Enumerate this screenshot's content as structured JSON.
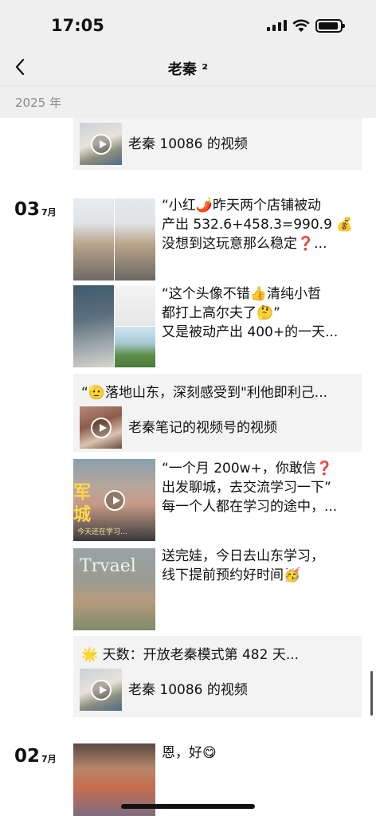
{
  "status_bar": {
    "time": "17:05"
  },
  "nav": {
    "title": "老秦 ²"
  },
  "year": "2025 年",
  "groups": [
    {
      "items": [
        {
          "type": "video-card",
          "title": "老秦 10086 的视频"
        }
      ]
    },
    {
      "day": "03",
      "month": "7月",
      "items": [
        {
          "type": "post",
          "lines": [
            "“小红🌶️昨天两个店铺被动",
            "产出 532.6+458.3=990.9 💰",
            "没想到这玩意那么稳定❓..."
          ]
        },
        {
          "type": "post",
          "lines": [
            "“这个头像不错👍清纯小哲",
            "都打上高尔夫了🤔”",
            "又是被动产出 400+的一天..."
          ]
        },
        {
          "type": "quote-video-card",
          "quote": "“🫡落地山东，深刻感受到\"利他即利己...",
          "title": "老秦笔记的视频号的视频"
        },
        {
          "type": "post",
          "thumb_overlay_lines": [
            "军",
            "城"
          ],
          "thumb_caption": "今天还在学习...",
          "lines": [
            "“一个月 200w+，你敢信❓",
            "出发聊城，去交流学习一下”",
            "每一个人都在学习的途中，..."
          ]
        },
        {
          "type": "post",
          "thumb_overlay_lines": [
            "Trvael"
          ],
          "lines": [
            "送完娃，今日去山东学习，",
            "线下提前预约好时间🥳"
          ]
        },
        {
          "type": "quote-video-card",
          "quote": "🌟 天数：开放老秦模式第 482 天...",
          "title": "老秦 10086 的视频"
        }
      ]
    },
    {
      "day": "02",
      "month": "7月",
      "items": [
        {
          "type": "post",
          "lines": [
            "恩，好😋"
          ]
        }
      ]
    }
  ],
  "icons": {
    "back": "chevron-left-icon",
    "signal": "cellular-signal-icon",
    "wifi": "wifi-icon",
    "battery": "battery-icon",
    "play": "play-icon"
  },
  "colors": {
    "header_bg": "#efefef",
    "card_bg": "#f3f3f3",
    "muted_text": "#8a8a8a"
  }
}
